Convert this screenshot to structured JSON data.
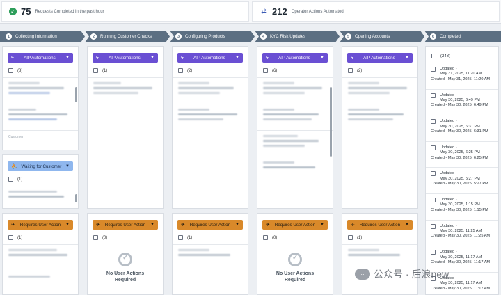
{
  "stats": {
    "completed_count": "75",
    "completed_label": "Requests Completed in the past hour",
    "automated_count": "212",
    "automated_label": "Operator Actions Automated"
  },
  "steps": [
    {
      "n": "1",
      "label": "Collecting Information"
    },
    {
      "n": "2",
      "label": "Running Customer Checks"
    },
    {
      "n": "3",
      "label": "Configuring Products"
    },
    {
      "n": "4",
      "label": "KYC Risk Updates"
    },
    {
      "n": "5",
      "label": "Opening Accounts"
    },
    {
      "n": "6",
      "label": "Completed"
    }
  ],
  "columns": [
    {
      "aip_label": "AIP Automations",
      "aip_count": "(8)",
      "waiting_label": "Waiting for Customer",
      "waiting_count": "(1)",
      "action_label": "Requires User Action",
      "action_count": "(1)",
      "item_hint": "Customer"
    },
    {
      "aip_label": "AIP Automations",
      "aip_count": "(1)",
      "action_label": "Requires User Action",
      "action_count": "(0)",
      "empty_text": "No User Actions Required"
    },
    {
      "aip_label": "AIP Automations",
      "aip_count": "(2)",
      "action_label": "Requires User Action",
      "action_count": "(1)"
    },
    {
      "aip_label": "AIP Automations",
      "aip_count": "(6)",
      "action_label": "Requires User Action",
      "action_count": "(0)",
      "empty_text": "No User Actions Required"
    },
    {
      "aip_label": "AIP Automations",
      "aip_count": "(2)",
      "action_label": "Requires User Action",
      "action_count": "(1)"
    }
  ],
  "completed": {
    "count": "(248)",
    "entries": [
      {
        "updated": "Updated -",
        "updated_date": "May 31, 2025, 11:20 AM",
        "created": "Created - May 31, 2025, 11:20 AM"
      },
      {
        "updated": "Updated -",
        "updated_date": "May 30, 2025, 6:49 PM",
        "created": "Created - May 30, 2025, 6:49 PM"
      },
      {
        "updated": "Updated -",
        "updated_date": "May 30, 2025, 6:31 PM",
        "created": "Created - May 30, 2025, 6:31 PM"
      },
      {
        "updated": "Updated -",
        "updated_date": "May 30, 2025, 6:25 PM",
        "created": "Created - May 30, 2025, 6:25 PM"
      },
      {
        "updated": "Updated -",
        "updated_date": "May 30, 2025, 5:27 PM",
        "created": "Created - May 30, 2025, 5:27 PM"
      },
      {
        "updated": "Updated -",
        "updated_date": "May 30, 2025, 1:15 PM",
        "created": "Created - May 30, 2025, 1:15 PM"
      },
      {
        "updated": "Updated -",
        "updated_date": "May 30, 2025, 11:25 AM",
        "created": "Created - May 30, 2025, 11:25 AM"
      },
      {
        "updated": "Updated -",
        "updated_date": "May 30, 2025, 11:17 AM",
        "created": "Created - May 30, 2025, 11:17 AM"
      },
      {
        "updated": "Updated -",
        "updated_date": "May 30, 2025, 11:17 AM",
        "created": "Created - May 30, 2025, 11:17 AM"
      }
    ]
  },
  "watermark": {
    "logo": "··",
    "text": "公众号 · 后浪new"
  },
  "colors": {
    "aip": "#6a4fd3",
    "waiting": "#8fb7ee",
    "action": "#d9892a",
    "step": "#5c6f82"
  },
  "icons": {
    "completed": "check-circle-icon",
    "automated": "automation-icon",
    "aip": "lightning-icon",
    "waiting": "person-wait-icon",
    "action": "user-action-icon",
    "chevron": "chevron-down-icon",
    "empty": "check-ring-icon"
  }
}
